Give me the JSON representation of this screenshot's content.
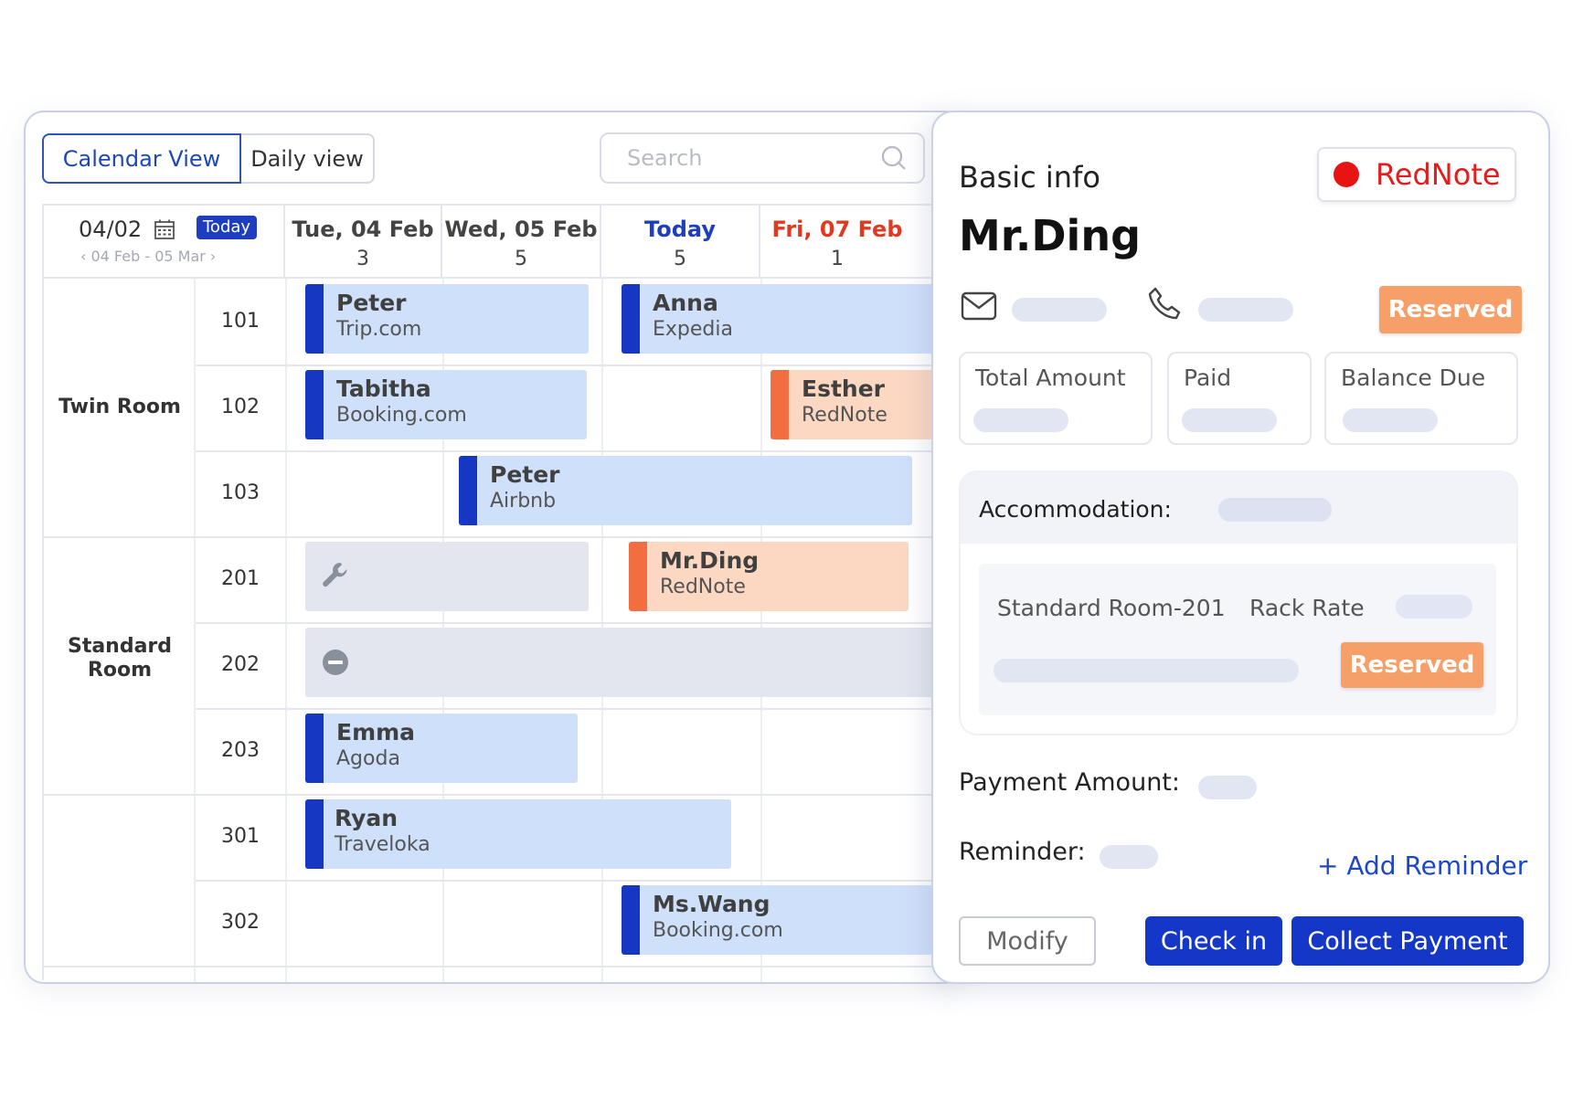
{
  "toolbar": {
    "calendar_view": "Calendar View",
    "daily_view": "Daily view",
    "search_placeholder": "Search"
  },
  "date_header": {
    "date": "04/02",
    "today_label": "Today",
    "range": "‹  04 Feb - 05 Mar  ›"
  },
  "days": [
    {
      "label": "Tue, 04 Feb",
      "count": "3",
      "color": "#444444"
    },
    {
      "label": "Wed, 05 Feb",
      "count": "5",
      "color": "#444444"
    },
    {
      "label": "Today",
      "count": "5",
      "color": "#1d3fbf"
    },
    {
      "label": "Fri, 07 Feb",
      "count": "1",
      "color": "#e0391f"
    }
  ],
  "room_types": [
    "Twin Room",
    "Standard Room",
    ""
  ],
  "rooms": [
    "101",
    "102",
    "103",
    "201",
    "202",
    "203",
    "301",
    "302"
  ],
  "bookings": [
    {
      "name": "Peter",
      "source": "Trip.com"
    },
    {
      "name": "Anna",
      "source": "Expedia"
    },
    {
      "name": "Tabitha",
      "source": "Booking.com"
    },
    {
      "name": "Esther",
      "source": "RedNote"
    },
    {
      "name": "Peter",
      "source": "Airbnb"
    },
    {
      "name": "Mr.Ding",
      "source": "RedNote"
    },
    {
      "name": "Emma",
      "source": "Agoda"
    },
    {
      "name": "Ryan",
      "source": "Traveloka"
    },
    {
      "name": "Ms.Wang",
      "source": "Booking.com"
    }
  ],
  "detail": {
    "section_title": "Basic info",
    "channel": "RedNote",
    "guest_name": "Mr.Ding",
    "status": "Reserved",
    "total_amount": "Total Amount",
    "paid": "Paid",
    "balance_due": "Balance Due",
    "accommodation": "Accommodation:",
    "room": "Standard Room-201",
    "rack_rate": "Rack Rate",
    "payment_amount": "Payment Amount:",
    "reminder": "Reminder:",
    "add_reminder": "+ Add Reminder",
    "modify": "Modify",
    "check_in": "Check in",
    "collect_payment": "Collect Payment"
  },
  "colors": {
    "accent": "#1d47b8",
    "booking_blue": "#cfe0fb",
    "booking_orange": "#fcd8c3",
    "reserved": "#f79f68",
    "channel_red": "#e81414"
  }
}
